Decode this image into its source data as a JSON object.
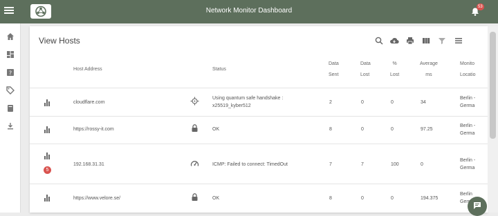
{
  "app": {
    "title": "Network Monitor Dashboard",
    "notification_count": "53"
  },
  "sidebar": {
    "items": [
      {
        "icon": "home-icon"
      },
      {
        "icon": "dashboard-icon"
      },
      {
        "icon": "help-icon"
      },
      {
        "icon": "tag-icon"
      },
      {
        "icon": "book-icon"
      },
      {
        "icon": "download-icon"
      }
    ]
  },
  "panel": {
    "title": "View Hosts",
    "toolbar": [
      "search-icon",
      "cloud-download-icon",
      "print-icon",
      "columns-icon",
      "filter-icon",
      "list-icon"
    ]
  },
  "table": {
    "headers": {
      "host": "Host Address",
      "status": "Status",
      "sent": [
        "Data",
        "Sent"
      ],
      "lost": [
        "Data",
        "Lost"
      ],
      "pct": [
        "%",
        "Lost"
      ],
      "avg": [
        "Average",
        "ms"
      ],
      "loc": [
        "Monito",
        "Locatio"
      ]
    },
    "rows": [
      {
        "host": "cloudflare.com",
        "status": [
          "Using quantum safe handshake :",
          "x25519_kyber512"
        ],
        "sent": "2",
        "lost": "0",
        "pct": "0",
        "avg": "34",
        "loc": [
          "Berlin -",
          "Germa"
        ],
        "proto_icon": "crosshair-icon",
        "badge": ""
      },
      {
        "host": "https://rossy-it.com",
        "status": [
          "OK"
        ],
        "sent": "8",
        "lost": "0",
        "pct": "0",
        "avg": "97.25",
        "loc": [
          "Berlin -",
          "Germa"
        ],
        "proto_icon": "lock-icon",
        "badge": ""
      },
      {
        "host": "192.168.31.31",
        "status": [
          "ICMP: Failed to connect: TimedOut"
        ],
        "sent": "7",
        "lost": "7",
        "pct": "100",
        "avg": "0",
        "loc": [
          "Berlin -",
          "Germa"
        ],
        "proto_icon": "speed-icon",
        "badge": "5"
      },
      {
        "host": "https://www.velore.se/",
        "status": [
          "OK"
        ],
        "sent": "8",
        "lost": "0",
        "pct": "0",
        "avg": "194.375",
        "loc": [
          "Berlin",
          "Germa"
        ],
        "proto_icon": "lock-icon",
        "badge": ""
      }
    ]
  }
}
